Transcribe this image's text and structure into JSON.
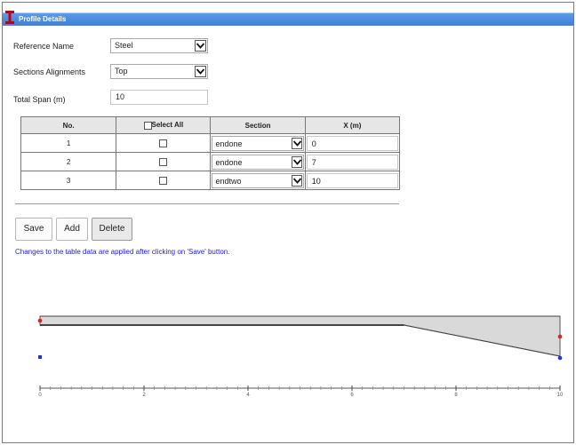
{
  "window": {
    "title": "Profile Details",
    "accent": "#3f7fd6"
  },
  "form": {
    "reference_name_label": "Reference Name",
    "reference_name_value": "Steel",
    "alignment_label": "Sections Alignments",
    "alignment_value": "Top",
    "span_label": "Total Span (m)",
    "span_value": "10"
  },
  "table": {
    "headers": {
      "no": "No.",
      "select_all": "Select All",
      "section": "Section",
      "x": "X (m)"
    },
    "rows": [
      {
        "no": "1",
        "section": "endone",
        "x": "0"
      },
      {
        "no": "2",
        "section": "endone",
        "x": "7"
      },
      {
        "no": "3",
        "section": "endtwo",
        "x": "10"
      }
    ]
  },
  "buttons": {
    "save": "Save",
    "add": "Add",
    "delete": "Delete"
  },
  "note": "Changes to the table data are applied after clicking on 'Save' button.",
  "profile_plot": {
    "x_ticks": [
      "0",
      "2",
      "4",
      "6",
      "8",
      "10"
    ],
    "x_min": 0,
    "x_max": 10,
    "points": [
      {
        "x": 0,
        "color": "#e02020",
        "level": "top"
      },
      {
        "x": 0,
        "color": "#2030e0",
        "level": "bottom"
      },
      {
        "x": 10,
        "color": "#e02020",
        "level": "top"
      },
      {
        "x": 10,
        "color": "#2030e0",
        "level": "bottom"
      }
    ],
    "taper_start_x": 7,
    "fill_color": "#d9d9d9"
  }
}
